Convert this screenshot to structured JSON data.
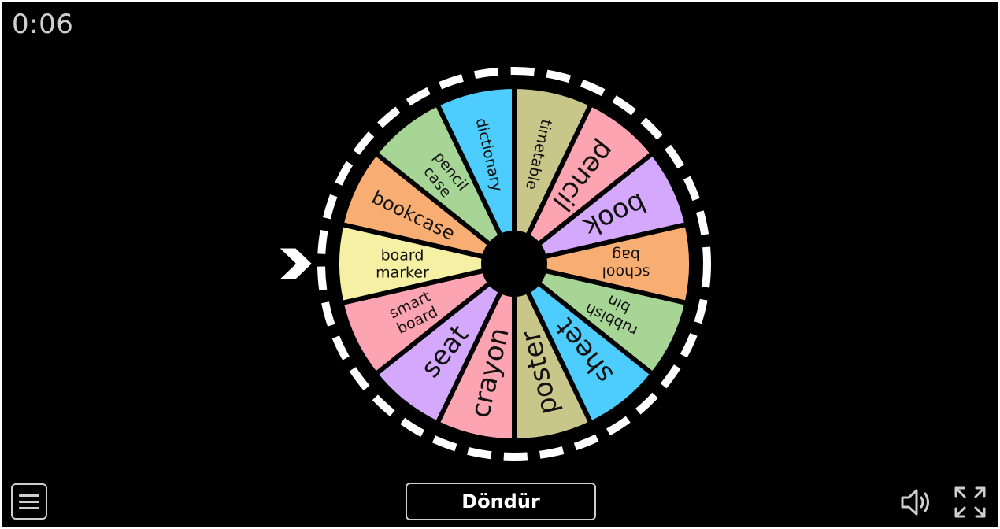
{
  "timer": "0:06",
  "spin_button": "Döndür",
  "icons": {
    "menu": "menu-icon",
    "sound": "speaker-icon",
    "fullscreen": "fullscreen-icon",
    "pointer": "chevron-right-icon"
  },
  "wheel": {
    "hub_color": "#000000",
    "rim_color": "#ffffff",
    "segments": [
      {
        "label": "timetable",
        "color": "#c9c689"
      },
      {
        "label": "pencil",
        "color": "#fda4b3"
      },
      {
        "label": "book",
        "color": "#d4a9fd"
      },
      {
        "label": "school bag",
        "color": "#f8ad72"
      },
      {
        "label": "rubbish bin",
        "color": "#a7d596"
      },
      {
        "label": "sheet",
        "color": "#4dcdfd"
      },
      {
        "label": "poster",
        "color": "#c9c689"
      },
      {
        "label": "crayon",
        "color": "#fda4b3"
      },
      {
        "label": "seat",
        "color": "#d4a9fd"
      },
      {
        "label": "smart board",
        "color": "#fda4b3"
      },
      {
        "label": "board marker",
        "color": "#f5f0a4"
      },
      {
        "label": "bookcase",
        "color": "#f8ad72"
      },
      {
        "label": "pencil case",
        "color": "#a7d596"
      },
      {
        "label": "dictionary",
        "color": "#4dcdfd"
      }
    ]
  }
}
